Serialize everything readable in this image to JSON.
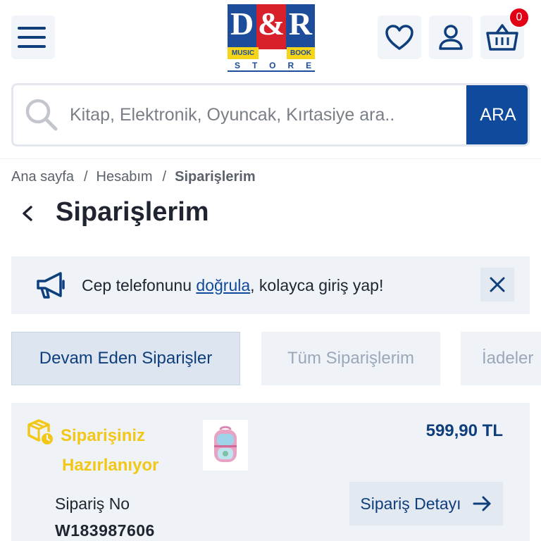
{
  "header": {
    "logo": {
      "d": "D",
      "amp": "&",
      "r": "R",
      "music": "MUSIC",
      "book": "BOOK",
      "store": "STORE"
    },
    "cart_count": "0"
  },
  "search": {
    "placeholder": "Kitap, Elektronik, Oyuncak, Kırtasiye ara..",
    "button_label": "ARA"
  },
  "breadcrumb": {
    "home": "Ana sayfa",
    "account": "Hesabım",
    "current": "Siparişlerim",
    "separator": "/"
  },
  "page": {
    "title": "Siparişlerim"
  },
  "notice": {
    "prefix": "Cep telefonunu ",
    "link": "doğrula",
    "suffix": ", kolayca giriş yap!"
  },
  "tabs": [
    {
      "label": "Devam Eden Siparişler"
    },
    {
      "label": "Tüm Siparişlerim"
    },
    {
      "label": "İadeler"
    }
  ],
  "order": {
    "status_line1": "Siparişiniz",
    "status_line2": "Hazırlanıyor",
    "price": "599,90 TL",
    "order_no_label": "Sipariş No",
    "order_no": "W183987606",
    "detail_button": "Sipariş Detayı"
  },
  "colors": {
    "brand_blue": "#0f4a9c",
    "logo_red": "#d8202a",
    "logo_yellow": "#f6d417",
    "status_yellow": "#f2c718",
    "badge_red": "#e30016"
  },
  "icons": [
    "hamburger-menu-icon",
    "heart-icon",
    "user-icon",
    "basket-icon",
    "search-icon",
    "chevron-left-icon",
    "megaphone-icon",
    "close-icon",
    "package-clock-icon",
    "arrow-right-icon"
  ]
}
